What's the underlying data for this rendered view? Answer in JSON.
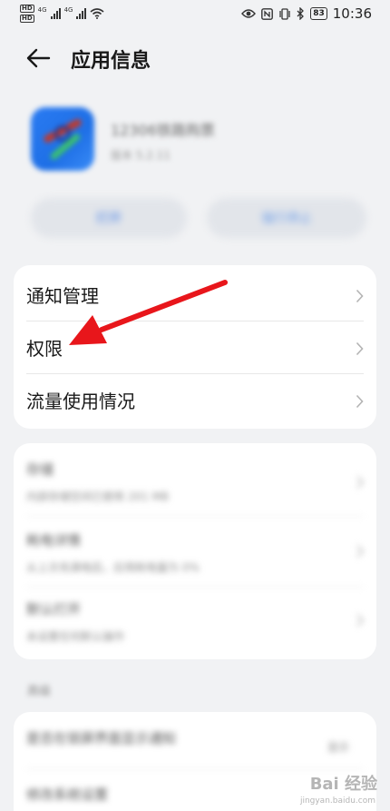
{
  "status_bar": {
    "sim1_tag": "HD",
    "sim2_tag": "HD",
    "network_1": "4G",
    "network_2": "4G",
    "battery": "83",
    "time": "10:36"
  },
  "title_bar": {
    "title": "应用信息"
  },
  "app": {
    "name": "12306铁路购票",
    "version": "版本 5.2.11"
  },
  "actions": {
    "open_label": "打开",
    "stop_label": "强行停止"
  },
  "settings": {
    "items": [
      {
        "label": "通知管理"
      },
      {
        "label": "权限"
      },
      {
        "label": "流量使用情况"
      }
    ]
  },
  "details": {
    "items": [
      {
        "title": "存储",
        "subtitle": "内部存储空间已使用 201 MB"
      },
      {
        "title": "耗电详情",
        "subtitle": "从上次充满电后，应用耗电量为 0%"
      },
      {
        "title": "默认打开",
        "subtitle": "未设置任何默认操作"
      }
    ]
  },
  "section": {
    "label": "高级"
  },
  "advanced": {
    "items": [
      {
        "title": "是否在锁屏界面显示通知",
        "value": "显示"
      },
      {
        "title": "修改系统设置"
      }
    ]
  },
  "watermark": {
    "text": "Bai 经验",
    "sub": "jingyan.baidu.com"
  },
  "colors": {
    "accent": "#3d7ae6",
    "annotation_arrow": "#e8161b",
    "page_background": "#f1f2f4"
  }
}
